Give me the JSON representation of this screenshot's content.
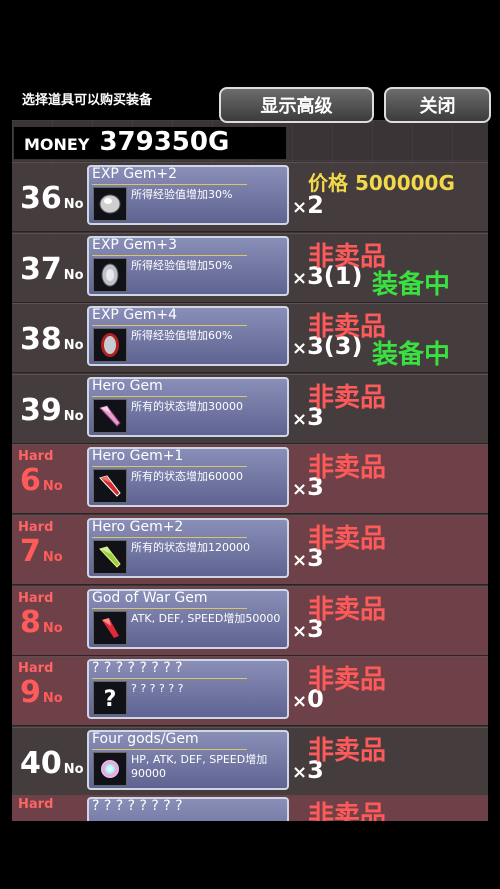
{
  "header": {
    "caption": "选择道具可以购买装备",
    "show_advanced": "显示高级",
    "close": "关闭"
  },
  "money": {
    "label": "MONEY",
    "value": "379350G"
  },
  "no_suffix": "No",
  "hard_label": "Hard",
  "rows": [
    {
      "num": "36",
      "hard": false,
      "name": "EXP Gem+2",
      "desc": "所得经验值增加30%",
      "icon": "exp-gem-silver-icon",
      "qty": "2",
      "price": "价格 500000G",
      "status": "",
      "equipped": ""
    },
    {
      "num": "37",
      "hard": false,
      "name": "EXP Gem+3",
      "desc": "所得经验值增加50%",
      "icon": "exp-gem-gray-icon",
      "qty": "3(1)",
      "price": "",
      "status": "非卖品",
      "equipped": "装备中"
    },
    {
      "num": "38",
      "hard": false,
      "name": "EXP Gem+4",
      "desc": "所得经验值增加60%",
      "icon": "exp-gem-red-icon",
      "qty": "3(3)",
      "price": "",
      "status": "非卖品",
      "equipped": "装备中"
    },
    {
      "num": "39",
      "hard": false,
      "name": "Hero Gem",
      "desc": "所有的状态增加30000",
      "icon": "hero-gem-pink-icon",
      "qty": "3",
      "price": "",
      "status": "非卖品",
      "equipped": ""
    },
    {
      "num": "6",
      "hard": true,
      "name": "Hero Gem+1",
      "desc": "所有的状态增加60000",
      "icon": "hero-gem-red-icon",
      "qty": "3",
      "price": "",
      "status": "非卖品",
      "equipped": ""
    },
    {
      "num": "7",
      "hard": true,
      "name": "Hero Gem+2",
      "desc": "所有的状态增加120000",
      "icon": "hero-gem-green-icon",
      "qty": "3",
      "price": "",
      "status": "非卖品",
      "equipped": ""
    },
    {
      "num": "8",
      "hard": true,
      "name": "God of War Gem",
      "desc": "ATK, DEF, SPEED增加50000",
      "icon": "war-gem-red-icon",
      "qty": "3",
      "price": "",
      "status": "非卖品",
      "equipped": ""
    },
    {
      "num": "9",
      "hard": true,
      "name": "? ? ? ? ? ? ? ?",
      "desc": "? ? ? ? ? ?",
      "icon": "question-mark-icon",
      "qty": "0",
      "price": "",
      "status": "非卖品",
      "equipped": ""
    },
    {
      "num": "40",
      "hard": false,
      "name": "Four gods/Gem",
      "desc": "HP, ATK, DEF, SPEED增加 90000",
      "icon": "rainbow-orb-icon",
      "qty": "3",
      "price": "",
      "status": "非卖品",
      "equipped": ""
    }
  ],
  "partial_row": {
    "hard": "Hard",
    "name": "? ? ? ? ? ? ? ?",
    "status": "非卖品"
  },
  "colors": {
    "status": "#ff5a5a",
    "price": "#f2d94a",
    "equipped": "#39e040",
    "hard_num": "#ff5b5b"
  }
}
